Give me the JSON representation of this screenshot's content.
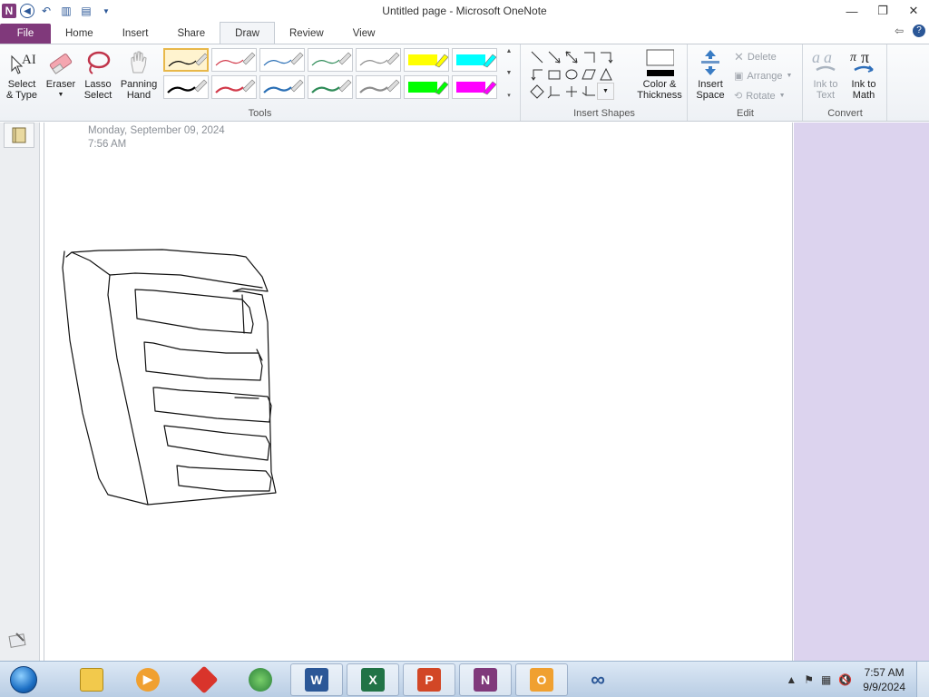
{
  "window": {
    "title": "Untitled page - Microsoft OneNote",
    "app_icon_letter": "N",
    "minimize": "—",
    "restore": "❐",
    "close": "✕"
  },
  "tabs": [
    "File",
    "Home",
    "Insert",
    "Share",
    "Draw",
    "Review",
    "View"
  ],
  "active_tab": "Draw",
  "ribbon": {
    "tools": {
      "label": "Tools",
      "select_type": [
        "Select",
        "& Type"
      ],
      "eraser": "Eraser",
      "lasso": [
        "Lasso",
        "Select"
      ],
      "panning": [
        "Panning",
        "Hand"
      ],
      "pens_row1": [
        "#000000",
        "#d23a4a",
        "#2a6fb5",
        "#2e8b57",
        "#8c8c8c",
        "#ffff00",
        "#00ffff"
      ],
      "pens_row2": [
        "#000000",
        "#d23a4a",
        "#2a6fb5",
        "#2e8b57",
        "#8c8c8c",
        "#00ff00",
        "#ff00ff"
      ]
    },
    "insert_shapes": {
      "label": "Insert Shapes",
      "color_thickness": [
        "Color &",
        "Thickness"
      ]
    },
    "edit": {
      "label": "Edit",
      "insert_space": [
        "Insert",
        "Space"
      ],
      "delete": "Delete",
      "arrange": "Arrange",
      "rotate": "Rotate"
    },
    "convert": {
      "label": "Convert",
      "ink_to_text": [
        "Ink to",
        "Text"
      ],
      "ink_to_math": [
        "Ink to",
        "Math"
      ]
    }
  },
  "page": {
    "date": "Monday, September  09, 2024",
    "time": "7:56 AM"
  },
  "taskbar": {
    "items": [
      "explorer",
      "media-player",
      "gallery",
      "ie",
      "word",
      "excel",
      "powerpoint",
      "onenote",
      "outlook",
      "infinity"
    ],
    "clock_time": "7:57 AM",
    "clock_date": "9/9/2024"
  },
  "colors": {
    "file_tab": "#80397b",
    "right_pane": "#dcd3ee"
  }
}
